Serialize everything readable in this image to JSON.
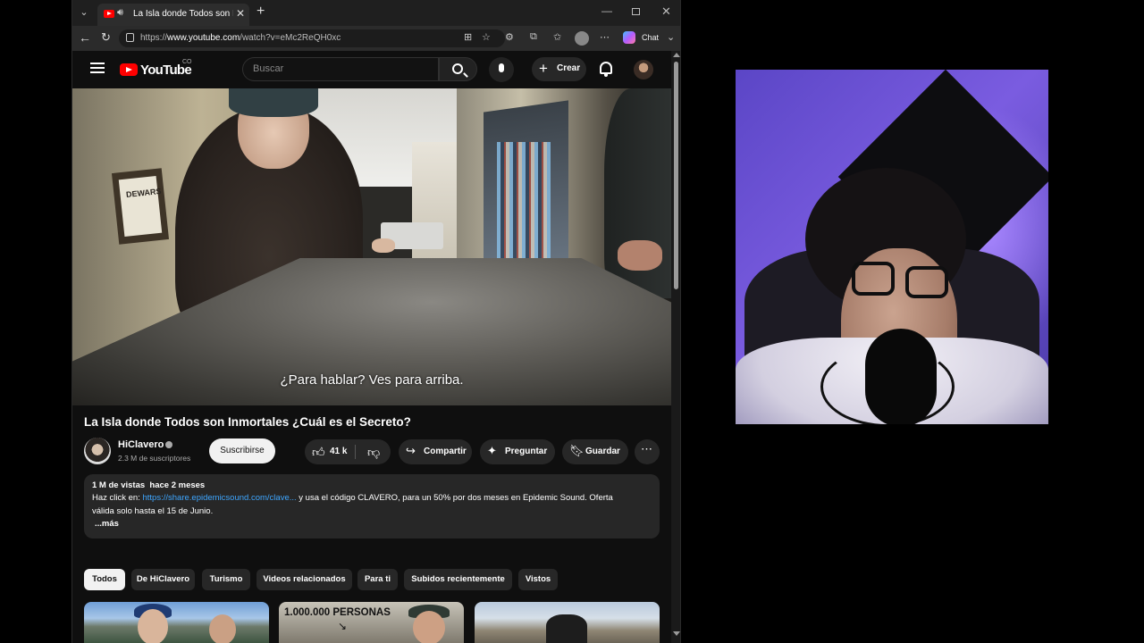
{
  "browser": {
    "tab_title": "La Isla donde Todos son Inmortales ¿Cuál es el Secreto? - YouTube",
    "url_prefix": "https://",
    "url_host": "www.youtube.com",
    "url_path": "/watch?v=eMc2ReQH0xc",
    "chat_label": "Chat"
  },
  "youtube": {
    "logo_text": "YouTube",
    "country_code": "CO",
    "search_placeholder": "Buscar",
    "create_label": "Crear"
  },
  "video": {
    "subtitle": "¿Para hablar? Ves para arriba.",
    "frame_text": "DEWARS"
  },
  "title": "La Isla donde Todos son Inmortales ¿Cuál es el Secreto?",
  "channel": {
    "name": "HiClavero",
    "subscribers": "2.3 M de suscriptores",
    "subscribe_label": "Suscribirse"
  },
  "actions": {
    "likes": "41 k",
    "share": "Compartir",
    "ask": "Preguntar",
    "save": "Guardar"
  },
  "description": {
    "meta": "1 M de vistas  hace 2 meses",
    "line1_prefix": "Haz click en: ",
    "link": "https://share.epidemicsound.com/clave...",
    "line1_suffix": " y usa el código CLAVERO, para un 50% por dos meses en Epidemic Sound. Oferta",
    "line2": "válida solo hasta el 15 de Junio.",
    "more": "...más"
  },
  "chips": [
    "Todos",
    "De HiClavero",
    "Turismo",
    "Videos relacionados",
    "Para ti",
    "Subidos recientemente",
    "Vistos"
  ],
  "thumbnails": {
    "t2_text": "1.000.000 PERSONAS"
  }
}
